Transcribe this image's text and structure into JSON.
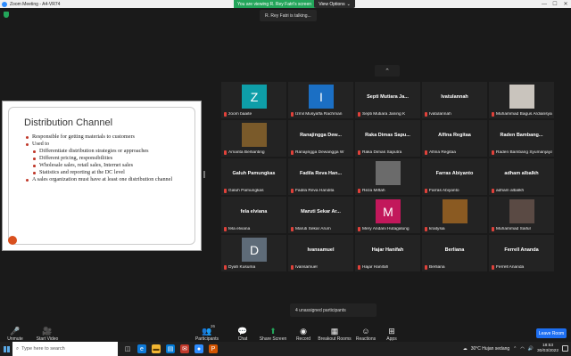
{
  "window": {
    "title": "Zoom Meeting - A4-VR74",
    "min": "—",
    "max": "☐",
    "close": "✕"
  },
  "banner": {
    "viewing": "You are viewing R. Rey Fatri's screen",
    "view_options": "View Options",
    "chevron": "⌄"
  },
  "talking": "R. Rey Fatri is talking...",
  "slide": {
    "title": "Distribution Channel",
    "bullets": [
      {
        "level": 1,
        "text": "Responsible for getting materials to customers"
      },
      {
        "level": 1,
        "text": "Used to"
      },
      {
        "level": 2,
        "text": "Differentiate distribution strategies or approaches"
      },
      {
        "level": 2,
        "text": "Different pricing, responsibilities"
      },
      {
        "level": 2,
        "text": "Wholesale sales,  retail sales, Internet sales"
      },
      {
        "level": 2,
        "text": "Statistics and reporting at the DC level"
      },
      {
        "level": 1,
        "text": "A sales organization must have at least one distribution channel"
      }
    ]
  },
  "gallery": {
    "collapse": "⌃",
    "tiles": [
      {
        "name": "zoom baaite",
        "avatar": "Z",
        "avatar_color": "#0e9ea8"
      },
      {
        "name": "Izmil Musyaffa Rachman",
        "avatar": "I",
        "avatar_color": "#1b6fc4"
      },
      {
        "name": "Septi Mutiara Janing K",
        "big": "Septi  Mutiara  Ja..."
      },
      {
        "name": "Ivatulannah",
        "big": "Ivatulannah"
      },
      {
        "name": "Muhammad Bagus Ardiansyah",
        "avatar": "",
        "avatar_color": "#c9c4bd"
      },
      {
        "name": "Amanta Berlianting",
        "avatar": "",
        "avatar_color": "#7a5a2a"
      },
      {
        "name": "Ranajingga Dewangga W",
        "big": "Ranajingga  Dew..."
      },
      {
        "name": "Raka Dimas Saputra",
        "big": "Raka  Dimas  Sapu..."
      },
      {
        "name": "Alfina Regitaa",
        "big": "Alfina Regitaa"
      },
      {
        "name": "Raden Bambang Syumanjaya",
        "big": "Raden  Bambang..."
      },
      {
        "name": "Galuh Pamungkas",
        "big": "Galuh Pamungkas"
      },
      {
        "name": "Fadila Reva Handita",
        "big": "Fadila  Reva  Han..."
      },
      {
        "name": "Reza Miftah",
        "avatar": "",
        "avatar_color": "#6b6b6b"
      },
      {
        "name": "Farras Abiyanto",
        "big": "Farras Abiyanto"
      },
      {
        "name": "adham albalkh",
        "big": "adham albalkh"
      },
      {
        "name": "fela elviana",
        "big": "fela elviana"
      },
      {
        "name": "Maruti Sekar Arum",
        "big": "Maruti  Sekar  Ar..."
      },
      {
        "name": "Mery Andani Hutagalung",
        "avatar": "M",
        "avatar_color": "#c2185b"
      },
      {
        "name": "kraitysia",
        "avatar": "",
        "avatar_color": "#8a5a22"
      },
      {
        "name": "Muhammad Saiful",
        "avatar": "",
        "avatar_color": "#5a4a44"
      },
      {
        "name": "Dyah Kusuma",
        "avatar": "D",
        "avatar_color": "#5e6b78"
      },
      {
        "name": "Ivansamuel",
        "big": "Ivansamuel"
      },
      {
        "name": "Hajar Hanifah",
        "big": "Hajar Hanifah"
      },
      {
        "name": "Berliana",
        "big": "Berliana"
      },
      {
        "name": "Ferrell Ananda",
        "big": "Ferrell Ananda"
      }
    ]
  },
  "unassigned": "4 unassigned participants",
  "toolbar": {
    "unmute": "Unmute",
    "start_video": "Start Video",
    "participants": "Participants",
    "participants_count": "26",
    "chat": "Chat",
    "share_screen": "Share Screen",
    "record": "Record",
    "breakout": "Breakout Rooms",
    "reactions": "Reactions",
    "apps": "Apps",
    "leave": "Leave Room"
  },
  "taskbar": {
    "search_placeholder": "Type here to search",
    "weather": "30°C  Hujan sedang",
    "time": "18:53",
    "date": "30/03/2022"
  }
}
